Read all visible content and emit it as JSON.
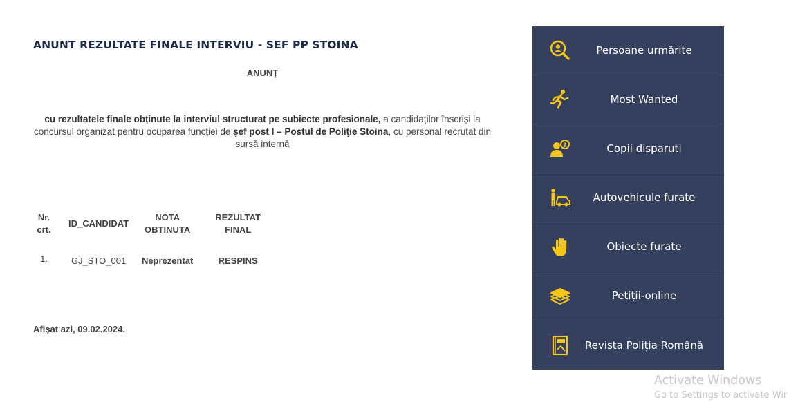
{
  "article": {
    "title": "ANUNT REZULTATE FINALE INTERVIU - SEF PP STOINA",
    "heading": "ANUNŢ",
    "intro": {
      "part1": "cu rezultatele finale obținute la interviul structurat pe subiecte profesionale,",
      "part2": " a candidaților  înscriși la concursul organizat pentru ocuparea funcției de ",
      "part3": "şef post I – Postul de Poliţie Stoina",
      "part4": ", cu personal recrutat din sursă internă"
    },
    "table": {
      "headers": {
        "nr_line1": "Nr.",
        "nr_line2": "crt.",
        "id": "ID_CANDIDAT",
        "nota_line1": "NOTA",
        "nota_line2": "OBTINUTA",
        "rez_line1": "REZULTAT",
        "rez_line2": "FINAL"
      },
      "rows": [
        {
          "nr": "1.",
          "id": "GJ_STO_001",
          "nota": "Neprezentat",
          "rezultat": "RESPINS"
        }
      ]
    },
    "posted": "Afişat azi, 09.02.2024."
  },
  "sidebar": {
    "items": [
      {
        "label": "Persoane urmărite",
        "icon": "search-person-icon"
      },
      {
        "label": "Most Wanted",
        "icon": "running-man-icon"
      },
      {
        "label": "Copii disparuti",
        "icon": "missing-child-icon"
      },
      {
        "label": "Autovehicule furate",
        "icon": "stolen-car-icon"
      },
      {
        "label": "Obiecte furate",
        "icon": "hand-icon"
      },
      {
        "label": "Petiții-online",
        "icon": "documents-icon"
      },
      {
        "label": "Revista Poliția Română",
        "icon": "magazine-icon"
      }
    ],
    "colors": {
      "background": "#353f5e",
      "icon": "#f5c518",
      "text": "#ffffff"
    }
  },
  "watermark": {
    "line1": "Activate Windows",
    "line2": "Go to Settings to activate Wir"
  }
}
